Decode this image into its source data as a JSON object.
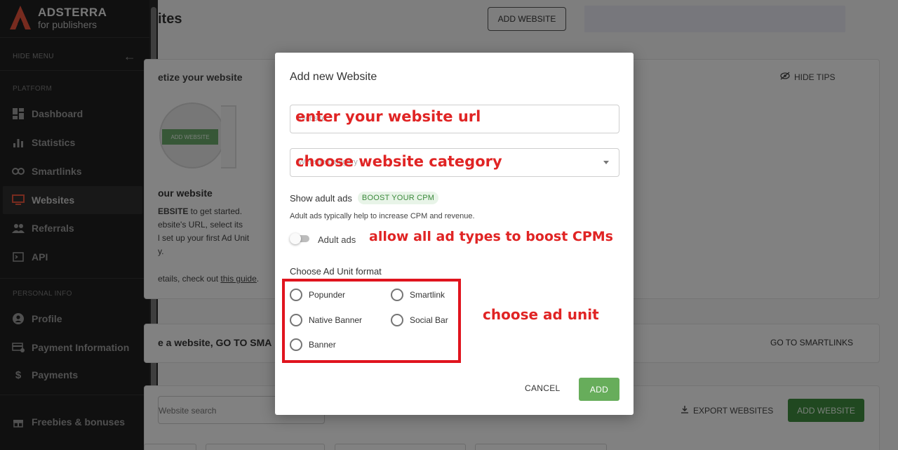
{
  "sidebar": {
    "brand_title": "ADSTERRA",
    "brand_sub": "for publishers",
    "hide_menu": "HIDE MENU",
    "section_platform": "PLATFORM",
    "section_personal": "PERSONAL INFO",
    "items": [
      {
        "label": "Dashboard",
        "icon": "dashboard-icon"
      },
      {
        "label": "Statistics",
        "icon": "bar-chart-icon"
      },
      {
        "label": "Smartlinks",
        "icon": "link-icon"
      },
      {
        "label": "Websites",
        "icon": "monitor-icon"
      },
      {
        "label": "Referrals",
        "icon": "people-icon"
      },
      {
        "label": "API",
        "icon": "terminal-icon"
      },
      {
        "label": "Profile",
        "icon": "person-icon"
      },
      {
        "label": "Payment Information",
        "icon": "payment-icon"
      },
      {
        "label": "Payments",
        "icon": "dollar-icon"
      },
      {
        "label": "Freebies & bonuses",
        "icon": "gift-icon"
      }
    ],
    "active_item": "Websites"
  },
  "main": {
    "title": "ites",
    "add_website_header": "ADD WEBSITE",
    "tips": {
      "title": "etize your website",
      "hide_tips": "HIDE TIPS",
      "illus_button": "ADD WEBSITE",
      "heading": "our website",
      "line1_bold": "EBSITE",
      "line1_rest": " to get started.",
      "line2": "ebsite's URL, select its",
      "line3": "l set up your first Ad Unit",
      "line4": "y.",
      "line5_pre": "etails, check out ",
      "line5_link": "this guide",
      "line5_post": "."
    },
    "smartlinks_banner": "e a website, GO TO SMA",
    "go_to_smartlinks": "GO TO SMARTLINKS",
    "search_placeholder": "Website search",
    "export_websites": "EXPORT WEBSITES",
    "add_website_button": "ADD WEBSITE"
  },
  "modal": {
    "title": "Add new Website",
    "url_placeholder": "Website",
    "category_placeholder": "Website category",
    "show_adult_label": "Show adult ads",
    "boost_badge": "BOOST YOUR CPM",
    "adult_desc": "Adult ads typically help to increase CPM and revenue.",
    "toggle_label": "Adult ads",
    "toggle_on": false,
    "format_title": "Choose Ad Unit format",
    "formats": [
      "Popunder",
      "Smartlink",
      "Native Banner",
      "Social Bar",
      "Banner"
    ],
    "cancel": "CANCEL",
    "add": "ADD"
  },
  "annotations": {
    "url": "enter your website url",
    "category": "choose website category",
    "adult": "allow all ad types to boost CPMs",
    "unit": "choose ad unit"
  },
  "colors": {
    "accent_red": "#e02424",
    "add_green": "#67ad5b",
    "logo_orange": "#e5533d"
  }
}
